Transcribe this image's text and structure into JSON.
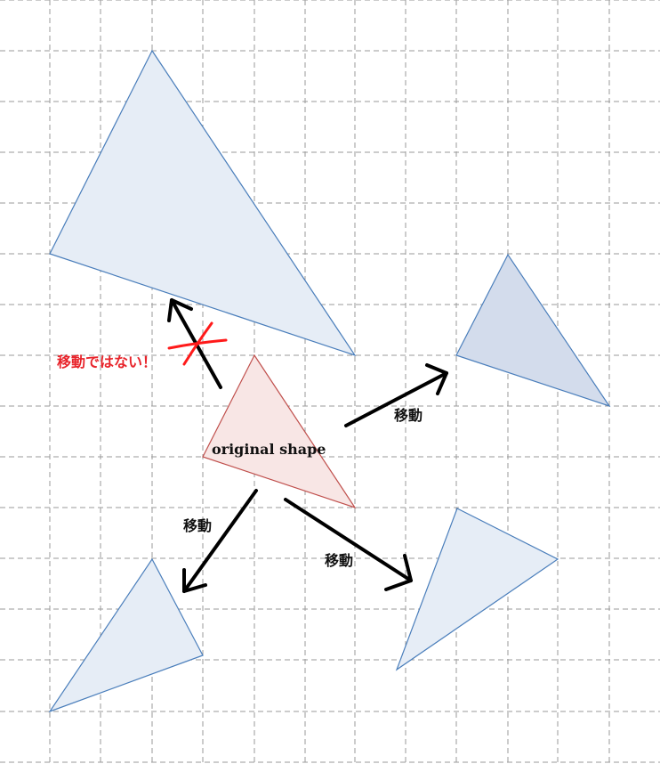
{
  "labels": {
    "original": "original shape",
    "move_upper_right": "移動",
    "move_lower_left": "移動",
    "move_lower_right": "移動",
    "not_move": "移動ではない！"
  },
  "colors": {
    "grid": "#9a9a9a",
    "shape_stroke": "#4a7ebb",
    "shape_fill": "#e6edf6",
    "shape_fill_dark": "#d3dcec",
    "original_stroke": "#c0504d",
    "original_fill": "#f8e6e5",
    "arrow": "#000000",
    "cross": "#ff1a1a",
    "not_move_text": "#e8242b"
  },
  "shapes": {
    "original": "original triangle",
    "copies": [
      "upper-left enlarged triangle (not a translation)",
      "upper-right translated triangle",
      "lower-left translated triangle",
      "lower-right translated triangle"
    ]
  }
}
